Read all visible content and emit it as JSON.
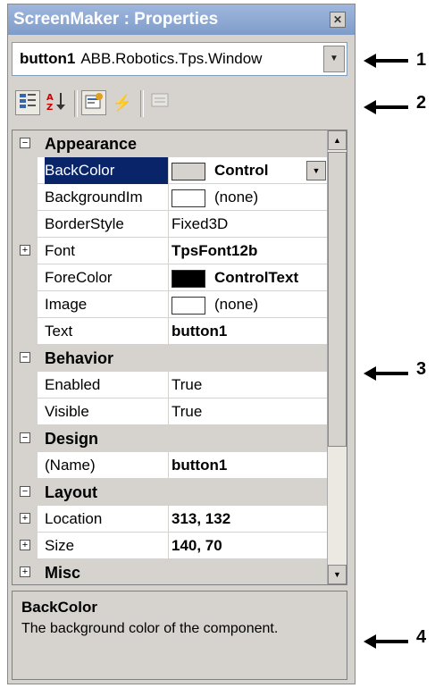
{
  "window": {
    "title": "ScreenMaker : Properties",
    "close_glyph": "✕"
  },
  "object_selector": {
    "name": "button1",
    "type": "ABB.Robotics.Tps.Window"
  },
  "toolbar": {
    "buttons": [
      {
        "name": "categorized-icon",
        "pressed": true
      },
      {
        "name": "alphabetical-icon",
        "pressed": false
      },
      {
        "name": "properties-icon",
        "pressed": true
      },
      {
        "name": "events-icon",
        "pressed": false
      },
      {
        "name": "property-pages-icon",
        "pressed": false
      }
    ]
  },
  "grid": {
    "rows": [
      {
        "kind": "category",
        "label": "Appearance"
      },
      {
        "kind": "prop",
        "name": "BackColor",
        "value": "Control",
        "swatch": "#d6d3ce",
        "bold": true,
        "selected": true,
        "dropdown": true
      },
      {
        "kind": "prop",
        "name": "BackgroundIm",
        "value": "(none)",
        "swatch": "#ffffff"
      },
      {
        "kind": "prop",
        "name": "BorderStyle",
        "value": "Fixed3D"
      },
      {
        "kind": "prop",
        "name": "Font",
        "value": "TpsFont12b",
        "bold": true,
        "expandable": true
      },
      {
        "kind": "prop",
        "name": "ForeColor",
        "value": "ControlText",
        "swatch": "#000000",
        "bold": true
      },
      {
        "kind": "prop",
        "name": "Image",
        "value": "(none)",
        "swatch": "#ffffff"
      },
      {
        "kind": "prop",
        "name": "Text",
        "value": "button1",
        "bold": true
      },
      {
        "kind": "category",
        "label": "Behavior"
      },
      {
        "kind": "prop",
        "name": "Enabled",
        "value": "True"
      },
      {
        "kind": "prop",
        "name": "Visible",
        "value": "True"
      },
      {
        "kind": "category",
        "label": "Design"
      },
      {
        "kind": "prop",
        "name": "(Name)",
        "value": "button1",
        "bold": true
      },
      {
        "kind": "category",
        "label": "Layout"
      },
      {
        "kind": "prop",
        "name": "Location",
        "value": "313, 132",
        "bold": true,
        "expandable": true
      },
      {
        "kind": "prop",
        "name": "Size",
        "value": "140, 70",
        "bold": true,
        "expandable": true
      },
      {
        "kind": "category-collapsed",
        "label": "Misc"
      }
    ]
  },
  "help": {
    "title": "BackColor",
    "description": "The background color of the component."
  },
  "callouts": [
    "1",
    "2",
    "3",
    "4"
  ],
  "colors": {
    "titlebar": "#7f9cc9",
    "selection": "#0a246a",
    "panel": "#d6d3ce"
  }
}
